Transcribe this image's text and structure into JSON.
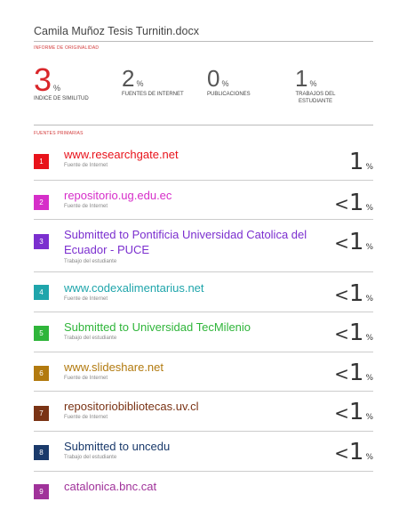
{
  "document": {
    "title": "Camila Muñoz Tesis Turnitin.docx"
  },
  "report": {
    "section_label": "INFORME DE ORIGINALIDAD",
    "stats": [
      {
        "value": "3",
        "unit": "%",
        "label": "INDICE DE SIMILITUD"
      },
      {
        "value": "2",
        "unit": "%",
        "label": "FUENTES DE INTERNET"
      },
      {
        "value": "0",
        "unit": "%",
        "label": "PUBLICACIONES"
      },
      {
        "value": "1",
        "unit": "%",
        "label": "TRABAJOS DEL ESTUDIANTE"
      }
    ]
  },
  "sources": {
    "section_label": "FUENTES PRIMARIAS",
    "items": [
      {
        "rank": "1",
        "name": "www.researchgate.net",
        "type": "Fuente de Internet",
        "prefix": "",
        "value": "1",
        "unit": "%",
        "color": "#e8131b"
      },
      {
        "rank": "2",
        "name": "repositorio.ug.edu.ec",
        "type": "Fuente de Internet",
        "prefix": "<",
        "value": "1",
        "unit": "%",
        "color": "#d62ec9"
      },
      {
        "rank": "3",
        "name": "Submitted to Pontificia Universidad Catolica del Ecuador - PUCE",
        "type": "Trabajo del estudiante",
        "prefix": "<",
        "value": "1",
        "unit": "%",
        "color": "#7b2fcf"
      },
      {
        "rank": "4",
        "name": "www.codexalimentarius.net",
        "type": "Fuente de Internet",
        "prefix": "<",
        "value": "1",
        "unit": "%",
        "color": "#1fa5ab"
      },
      {
        "rank": "5",
        "name": "Submitted to Universidad TecMilenio",
        "type": "Trabajo del estudiante",
        "prefix": "<",
        "value": "1",
        "unit": "%",
        "color": "#2fb53a"
      },
      {
        "rank": "6",
        "name": "www.slideshare.net",
        "type": "Fuente de Internet",
        "prefix": "<",
        "value": "1",
        "unit": "%",
        "color": "#b27a0f"
      },
      {
        "rank": "7",
        "name": "repositoriobibliotecas.uv.cl",
        "type": "Fuente de Internet",
        "prefix": "<",
        "value": "1",
        "unit": "%",
        "color": "#7a3315"
      },
      {
        "rank": "8",
        "name": "Submitted to uncedu",
        "type": "Trabajo del estudiante",
        "prefix": "<",
        "value": "1",
        "unit": "%",
        "color": "#1a3a6b"
      },
      {
        "rank": "9",
        "name": "catalonica.bnc.cat",
        "type": "",
        "prefix": "",
        "value": "",
        "unit": "",
        "color": "#a0329a"
      }
    ]
  }
}
